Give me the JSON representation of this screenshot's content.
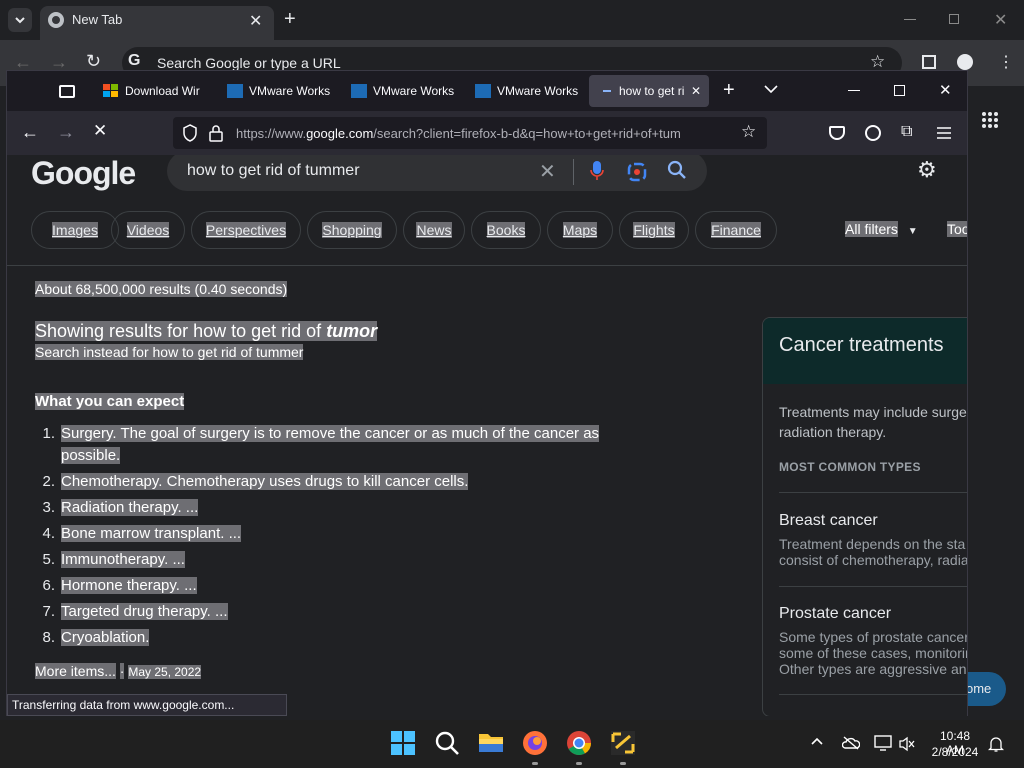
{
  "chrome": {
    "tab_title": "New Tab",
    "omnibox_placeholder": "Search Google or type a URL",
    "home_button_fragment": "ome"
  },
  "firefox": {
    "tabs": [
      {
        "label": "Download Wir"
      },
      {
        "label": "VMware Works"
      },
      {
        "label": "VMware Works"
      },
      {
        "label": "VMware Works"
      },
      {
        "label": "how to get ri"
      }
    ],
    "url_prefix": "https://www.",
    "url_domain": "google.com",
    "url_rest": "/search?client=firefox-b-d&q=how+to+get+rid+of+tum",
    "status_text": "Transferring data from www.google.com..."
  },
  "google": {
    "logo": "Google",
    "query": "how to get rid of tummer",
    "chips": [
      "Images",
      "Videos",
      "Perspectives",
      "Shopping",
      "News",
      "Books",
      "Maps",
      "Flights",
      "Finance"
    ],
    "all_filters": "All filters",
    "tools": "Too",
    "result_stats": "About 68,500,000 results (0.40 seconds)",
    "showing_prefix": "Showing results for",
    "showing_query": "how to get rid of",
    "showing_corrected": "tumor",
    "search_instead": "Search instead for how to get rid of tummer",
    "section_title": "What you can expect",
    "list_items": [
      {
        "num": "1.",
        "text": "Surgery. The goal of surgery is to remove the cancer or as much of the cancer as",
        "text2": "possible."
      },
      {
        "num": "2.",
        "text": "Chemotherapy. Chemotherapy uses drugs to kill cancer cells."
      },
      {
        "num": "3.",
        "text": "Radiation therapy. ..."
      },
      {
        "num": "4.",
        "text": "Bone marrow transplant. ..."
      },
      {
        "num": "5.",
        "text": "Immunotherapy. ..."
      },
      {
        "num": "6.",
        "text": "Hormone therapy. ..."
      },
      {
        "num": "7.",
        "text": "Targeted drug therapy. ..."
      },
      {
        "num": "8.",
        "text": "Cryoablation."
      }
    ],
    "more_items": "More items...",
    "date": "May 25, 2022",
    "knowledge_panel": {
      "title": "Cancer treatments",
      "desc1": "Treatments may include surge",
      "desc2": "radiation therapy.",
      "types_label": "MOST COMMON TYPES",
      "types": [
        {
          "name": "Breast cancer",
          "line1": "Treatment depends on the sta",
          "line2": "consist of chemotherapy, radia"
        },
        {
          "name": "Prostate cancer",
          "line1": "Some types of prostate cancer",
          "line2": "some of these cases, monitorin",
          "line3": "Other types are aggressive an"
        }
      ]
    }
  },
  "taskbar": {
    "time": "10:48 AM",
    "date": "2/8/2024"
  }
}
